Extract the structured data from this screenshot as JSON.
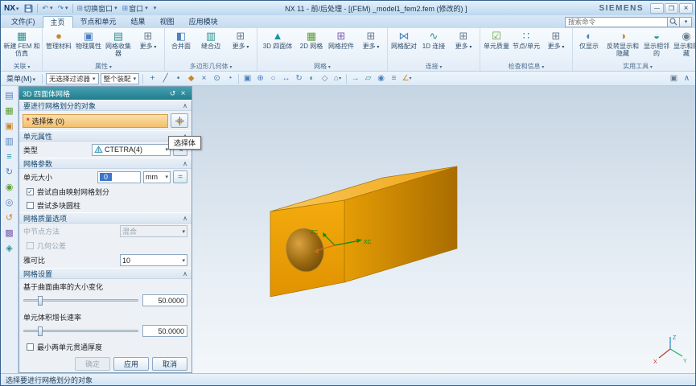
{
  "titlebar": {
    "logo": "NX",
    "title": "NX 11 - 前/后处理 - [(FEM) _model1_fem2.fem (修改的) ]",
    "brand": "SIEMENS",
    "switch_window": "切换窗口",
    "window_menu": "窗口"
  },
  "search": {
    "placeholder": "搜索命令"
  },
  "tabs": [
    {
      "id": "file",
      "label": "文件(F)"
    },
    {
      "id": "home",
      "label": "主页",
      "active": true
    },
    {
      "id": "nodes-and-elements",
      "label": "节点和单元"
    },
    {
      "id": "results",
      "label": "结果"
    },
    {
      "id": "view",
      "label": "视图"
    },
    {
      "id": "application-modules",
      "label": "应用模块"
    }
  ],
  "ribbon": {
    "groups": [
      {
        "id": "relations",
        "label": "关联",
        "items": [
          {
            "id": "new-fem-and-simulation",
            "label": "新建 FEM 和仿真",
            "glyph": "▦",
            "color": "#2f9390"
          }
        ]
      },
      {
        "id": "properties",
        "label": "属性",
        "items": [
          {
            "id": "manage-materials",
            "label": "管理材料",
            "glyph": "●",
            "color": "#c8882f"
          },
          {
            "id": "physical-properties",
            "label": "物理属性",
            "glyph": "▣",
            "color": "#4f81bd"
          },
          {
            "id": "mesh-collectors",
            "label": "网格收集器",
            "glyph": "▤",
            "color": "#2f9390"
          },
          {
            "id": "more-properties",
            "label": "更多",
            "glyph": "⊞",
            "color": "#6b7f92",
            "more": true
          }
        ]
      },
      {
        "id": "polygon-geometry",
        "label": "多边形几何体",
        "items": [
          {
            "id": "merge-face",
            "label": "合并面",
            "glyph": "◧",
            "color": "#4f81bd"
          },
          {
            "id": "stitch-edge",
            "label": "缝合边",
            "glyph": "▥",
            "color": "#2f9390"
          },
          {
            "id": "more-polygon-geometry",
            "label": "更多",
            "glyph": "⊞",
            "color": "#6b7f92",
            "more": true
          }
        ]
      },
      {
        "id": "mesh",
        "label": "网格",
        "items": [
          {
            "id": "3d-tetrahedral-mesh",
            "label": "3D 四面体",
            "glyph": "▲",
            "color": "#1b93a8"
          },
          {
            "id": "2d-mesh",
            "label": "2D 网格",
            "glyph": "▦",
            "color": "#5d9f33"
          },
          {
            "id": "mesh-control",
            "label": "网格控件",
            "glyph": "⊞",
            "color": "#7f5fb0"
          },
          {
            "id": "more-mesh",
            "label": "更多",
            "glyph": "⊞",
            "color": "#6b7f92",
            "more": true
          }
        ]
      },
      {
        "id": "connections",
        "label": "连接",
        "items": [
          {
            "id": "mesh-mating",
            "label": "网格配对",
            "glyph": "⋈",
            "color": "#4f81bd"
          },
          {
            "id": "1d-connection",
            "label": "1D 连接",
            "glyph": "∿",
            "color": "#2f9390"
          },
          {
            "id": "more-connections",
            "label": "更多",
            "glyph": "⊞",
            "color": "#6b7f92",
            "more": true
          }
        ]
      },
      {
        "id": "check-and-info",
        "label": "检查和信息",
        "items": [
          {
            "id": "element-quality",
            "label": "单元质量",
            "glyph": "☑",
            "color": "#5d9f33"
          },
          {
            "id": "node-element-info",
            "label": "节点/单元",
            "glyph": "∷",
            "color": "#1b93a8"
          },
          {
            "id": "more-check-info",
            "label": "更多",
            "glyph": "⊞",
            "color": "#6b7f92",
            "more": true
          }
        ]
      },
      {
        "id": "utilities",
        "label": "实用工具",
        "items": [
          {
            "id": "show-only",
            "label": "仅显示",
            "glyph": "◐",
            "color": "#4f81bd"
          },
          {
            "id": "invert-shown-and-hidden",
            "label": "反转显示和隐藏",
            "glyph": "◑",
            "color": "#c8882f"
          },
          {
            "id": "show-adjacent",
            "label": "显示相邻的",
            "glyph": "◒",
            "color": "#2f9390"
          },
          {
            "id": "show-and-hide",
            "label": "显示和隐藏",
            "glyph": "◉",
            "color": "#6b7f92"
          }
        ]
      }
    ]
  },
  "menu_row": {
    "menu": "菜单(M)",
    "filter": "无选择过滤器",
    "scope": "整个装配"
  },
  "toolbar": {
    "segments": [
      [
        {
          "id": "snap-point",
          "glyph": "+",
          "color": "#3f6f9f"
        },
        {
          "id": "endpoint-snap",
          "glyph": "╱",
          "color": "#3f6f9f"
        },
        {
          "id": "midpoint-snap",
          "glyph": "•",
          "color": "#3f6f9f"
        },
        {
          "id": "control-point-snap",
          "glyph": "◆",
          "color": "#c8882f"
        },
        {
          "id": "intersection-snap",
          "glyph": "×",
          "color": "#3f6f9f"
        },
        {
          "id": "arc-center-snap",
          "glyph": "⊙",
          "color": "#3f6f9f"
        },
        {
          "id": "quadrant-snap",
          "glyph": "◔",
          "color": "#3f6f9f"
        }
      ],
      [
        {
          "id": "fit-view",
          "glyph": "▣",
          "color": "#4f81bd"
        },
        {
          "id": "zoom-in-out",
          "glyph": "⊕",
          "color": "#4f81bd"
        },
        {
          "id": "zoom-window",
          "glyph": "○",
          "color": "#4f81bd"
        },
        {
          "id": "pan-view",
          "glyph": "↔",
          "color": "#4f81bd"
        },
        {
          "id": "rotate-view",
          "glyph": "↻",
          "color": "#4f81bd"
        },
        {
          "id": "shaded-display",
          "glyph": "◐",
          "color": "#2f9390"
        },
        {
          "id": "wireframe-display",
          "glyph": "◇",
          "color": "#6b7f92"
        },
        {
          "id": "orient-view",
          "glyph": "⌂",
          "color": "#6b7f92",
          "arrow": true
        }
      ],
      [
        {
          "id": "move-object",
          "glyph": "→",
          "color": "#6b7f92"
        },
        {
          "id": "edit-section",
          "glyph": "▱",
          "color": "#2f9390"
        },
        {
          "id": "show-hide-objects",
          "glyph": "◉",
          "color": "#4f81bd"
        },
        {
          "id": "layer-settings",
          "glyph": "≡",
          "color": "#6b7f92"
        },
        {
          "id": "measure",
          "glyph": "∠",
          "color": "#c8882f",
          "arrow": true
        }
      ]
    ],
    "right": [
      {
        "id": "user-interface-preferences",
        "glyph": "▣",
        "color": "#6b7f92"
      },
      {
        "id": "minimize-ribbon",
        "glyph": "∧",
        "color": "#3f6f9f"
      }
    ]
  },
  "sidebar": {
    "icons": [
      {
        "id": "simulation-navigator",
        "glyph": "▤",
        "color": "#4f81bd"
      },
      {
        "id": "post-processing-navigator",
        "glyph": "▦",
        "color": "#5d9f33"
      },
      {
        "id": "assembly-navigator",
        "glyph": "▣",
        "color": "#c8882f"
      },
      {
        "id": "constraint-navigator",
        "glyph": "▥",
        "color": "#4f81bd"
      },
      {
        "id": "part-navigator",
        "glyph": "≡",
        "color": "#1b93a8"
      },
      {
        "id": "reuse-library",
        "glyph": "↻",
        "color": "#4f81bd"
      },
      {
        "id": "hd3d-tools",
        "glyph": "◉",
        "color": "#5d9f33"
      },
      {
        "id": "web-browser",
        "glyph": "◎",
        "color": "#4f81bd"
      },
      {
        "id": "history",
        "glyph": "↺",
        "color": "#c8882f"
      },
      {
        "id": "process-studio",
        "glyph": "▩",
        "color": "#7f5fb0"
      },
      {
        "id": "roles",
        "glyph": "◈",
        "color": "#2f9390"
      }
    ]
  },
  "dialog": {
    "title": "3D 四面体网格",
    "objects_section": "要进行网格划分的对象",
    "select_body": {
      "required_mark": "*",
      "label": "选择体 (0)",
      "tooltip": "选择体"
    },
    "element_attrs": {
      "title": "单元属性",
      "type_label": "类型",
      "type_value": "CTETRA(4)"
    },
    "mesh_params": {
      "title": "网格参数",
      "size_label": "单元大小",
      "size_value": "0",
      "unit": "mm",
      "attempt_free_mapped": "尝试自由映射网格划分",
      "attempt_multi_block": "尝试多块圆柱"
    },
    "quality": {
      "title": "网格质量选项",
      "midnode_label": "中节点方法",
      "midnode_value": "混合",
      "geometry_tolerance": "几何公差",
      "jacobian_label": "雅可比",
      "jacobian_value": "10"
    },
    "settings": {
      "title": "网格设置",
      "curvature_label": "基于曲面曲率的大小变化",
      "curvature_value": "50.0000",
      "curvature_pct": 50,
      "growth_label": "单元体积增长速率",
      "growth_value": "50.0000",
      "growth_pct": 50,
      "min_two_elements": "最小两单元贯通厚度"
    },
    "buttons": {
      "ok": "确定",
      "apply": "应用",
      "cancel": "取消"
    }
  },
  "graphics": {
    "part_color": "#f0a202",
    "wcs": {
      "xc": "XC",
      "zc": "ZC"
    },
    "view_triad": {
      "x": "X",
      "y": "Y",
      "z": "Z"
    }
  },
  "status": {
    "text": "选择要进行网格划分的对象"
  }
}
